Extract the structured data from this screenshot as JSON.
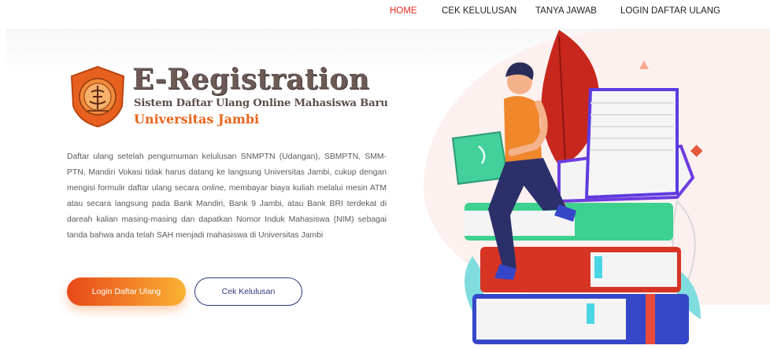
{
  "nav": {
    "items": [
      {
        "label": "HOME",
        "active": true
      },
      {
        "label": "CEK KELULUSAN",
        "active": false
      },
      {
        "label": "TANYA JAWAB",
        "active": false
      },
      {
        "label": "LOGIN DAFTAR ULANG",
        "active": false
      }
    ]
  },
  "brand": {
    "title": "E-Registration",
    "subtitle": "Sistem Daftar Ulang Online Mahasiswa Baru",
    "university": "Universitas Jambi"
  },
  "description": {
    "part1": "Daftar ulang setelah pengumuman kelulusan SNMPTN (Udangan), SBMPTN, SMM-PTN, Mandiri Vokasi tidak harus datang ke langsung Universitas Jambi, cukup dengan mengisi formulir daftar ulang secara ",
    "emphasis": "online",
    "part2": ", membayar biaya kuliah melalui mesin ATM atau secara langsung pada Bank Mandiri, Bank 9 Jambi, atau Bank BRI terdekat di dareah kalian masing-masing dan dapatkan Nomor Induk Mahasiswa (NIM) sebagai tanda bahwa anda telah SAH menjadi mahasiswa di Universitas Jambi"
  },
  "buttons": {
    "primary": "Login Daftar Ulang",
    "secondary": "Cek Kelulusan"
  },
  "colors": {
    "accent": "#e5281e",
    "primary_gradient_start": "#e9481a",
    "primary_gradient_end": "#f9b233",
    "outline": "#2d3a78",
    "university": "#e8651b"
  }
}
